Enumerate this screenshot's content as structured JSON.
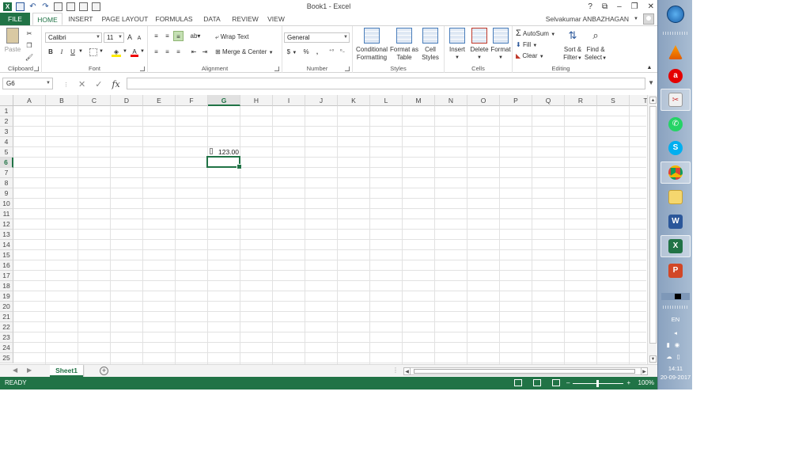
{
  "title": "Book1 - Excel",
  "user": "Selvakumar ANBAZHAGAN",
  "window_controls": [
    "?",
    "⧉",
    "–",
    "❐",
    "✕"
  ],
  "tabs": [
    "FILE",
    "HOME",
    "INSERT",
    "PAGE LAYOUT",
    "FORMULAS",
    "DATA",
    "REVIEW",
    "VIEW"
  ],
  "active_tab": "HOME",
  "ribbon": {
    "clipboard": {
      "label": "Clipboard",
      "paste": "Paste"
    },
    "font": {
      "label": "Font",
      "name": "Calibri",
      "size": "11",
      "bold": "B",
      "italic": "I",
      "underline": "U",
      "grow": "A",
      "shrink": "A",
      "color_letter": "A"
    },
    "alignment": {
      "label": "Alignment",
      "wrap": "Wrap Text",
      "merge": "Merge & Center"
    },
    "number": {
      "label": "Number",
      "format": "General",
      "currency": "$",
      "percent": "%",
      "comma": ","
    },
    "styles": {
      "label": "Styles",
      "conditional": "Conditional",
      "conditional2": "Formatting",
      "format_as": "Format as",
      "format_as2": "Table",
      "cell": "Cell",
      "cell2": "Styles"
    },
    "cells": {
      "label": "Cells",
      "insert": "Insert",
      "delete": "Delete",
      "format": "Format"
    },
    "editing": {
      "label": "Editing",
      "autosum": "AutoSum",
      "fill": "Fill",
      "clear": "Clear",
      "sort": "Sort &",
      "sort2": "Filter",
      "find": "Find &",
      "find2": "Select"
    }
  },
  "formula_bar": {
    "name_box": "G6",
    "fx": "fx",
    "cancel": "✕",
    "enter": "✓",
    "value": ""
  },
  "grid": {
    "columns": [
      "A",
      "B",
      "C",
      "D",
      "E",
      "F",
      "G",
      "H",
      "I",
      "J",
      "K",
      "L",
      "M",
      "N",
      "O",
      "P",
      "Q",
      "R",
      "S",
      "T"
    ],
    "rows": [
      "1",
      "2",
      "3",
      "4",
      "5",
      "6",
      "7",
      "8",
      "9",
      "10",
      "11",
      "12",
      "13",
      "14",
      "15",
      "16",
      "17",
      "18",
      "19",
      "20",
      "21",
      "22",
      "23",
      "24",
      "25"
    ],
    "selected_column": "G",
    "selected_row": "6",
    "cells": [
      {
        "ref": "G5",
        "value": "123.00"
      }
    ]
  },
  "sheets": {
    "tabs": [
      "Sheet1"
    ],
    "active": "Sheet1",
    "add": "+"
  },
  "status": {
    "ready": "READY",
    "zoom": "100%",
    "zoom_level": 1.0
  },
  "taskbar": {
    "apps": [
      "windows-start",
      "vlc",
      "airtel",
      "paint",
      "whatsapp",
      "skype",
      "chrome",
      "file-explorer",
      "word",
      "excel",
      "powerpoint"
    ],
    "lang": "EN",
    "time": "14:11",
    "date": "20-09-2017"
  },
  "colors": {
    "excel_green": "#217346",
    "grid_line": "#e2e2e2",
    "taskbar": "#a9bdd3"
  }
}
